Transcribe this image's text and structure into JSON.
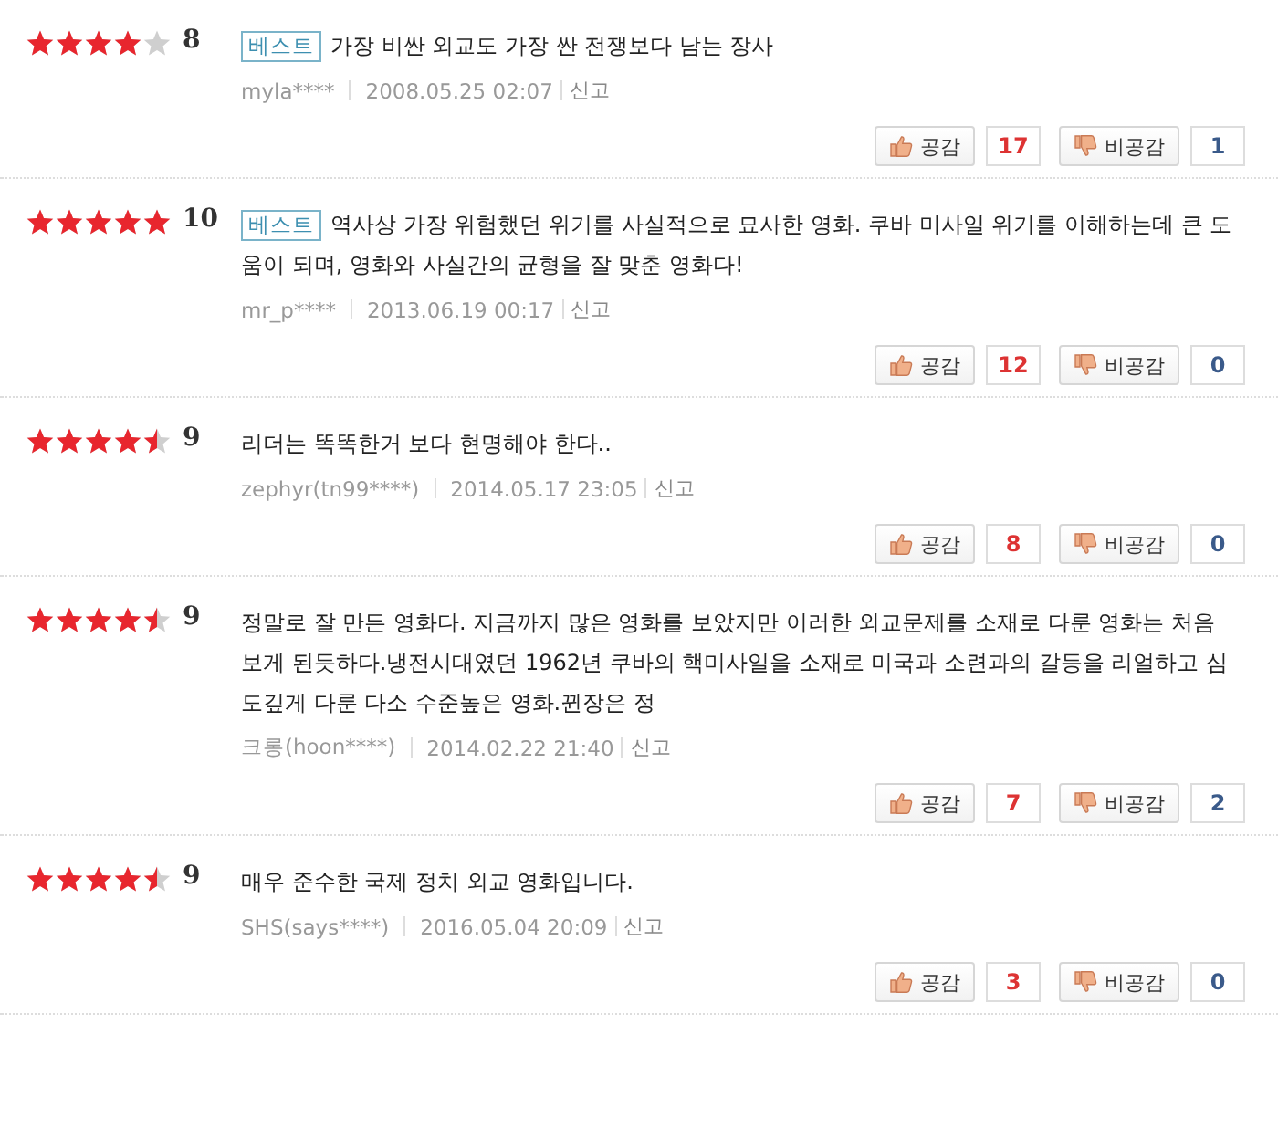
{
  "reviews": [
    {
      "stars": 4,
      "score": "8",
      "best": true,
      "best_label": "베스트",
      "text": "가장 비싼 외교도 가장 싼 전쟁보다 남는 장사",
      "author": "myla****",
      "date": "2008.05.25 02:07",
      "report": "신고",
      "agree_label": "공감",
      "agree_count": "17",
      "disagree_label": "비공감",
      "disagree_count": "1"
    },
    {
      "stars": 5,
      "score": "10",
      "best": true,
      "best_label": "베스트",
      "text": "역사상 가장 위험했던 위기를 사실적으로 묘사한 영화. 쿠바 미사일 위기를 이해하는데 큰 도움이 되며, 영화와 사실간의 균형을 잘 맞춘 영화다!",
      "author": "mr_p****",
      "date": "2013.06.19 00:17",
      "report": "신고",
      "agree_label": "공감",
      "agree_count": "12",
      "disagree_label": "비공감",
      "disagree_count": "0"
    },
    {
      "stars": 4.5,
      "score": "9",
      "best": false,
      "text": "리더는 똑똑한거 보다 현명해야 한다..",
      "author": "zephyr(tn99****)",
      "date": "2014.05.17 23:05",
      "report": "신고",
      "agree_label": "공감",
      "agree_count": "8",
      "disagree_label": "비공감",
      "disagree_count": "0"
    },
    {
      "stars": 4.5,
      "score": "9",
      "best": false,
      "text": "정말로 잘 만든 영화다. 지금까지 많은 영화를 보았지만 이러한 외교문제를 소재로 다룬 영화는 처음 보게 된듯하다.냉전시대였던 1962년 쿠바의 핵미사일을 소재로 미국과 소련과의 갈등을 리얼하고 심도깊게 다룬 다소 수준높은 영화.뀐장은 정",
      "author": "크롱(hoon****)",
      "date": "2014.02.22 21:40",
      "report": "신고",
      "agree_label": "공감",
      "agree_count": "7",
      "disagree_label": "비공감",
      "disagree_count": "2"
    },
    {
      "stars": 4.5,
      "score": "9",
      "best": false,
      "text": "매우 준수한 국제 정치 외교 영화입니다.",
      "author": "SHS(says****)",
      "date": "2016.05.04 20:09",
      "report": "신고",
      "agree_label": "공감",
      "agree_count": "3",
      "disagree_label": "비공감",
      "disagree_count": "0"
    }
  ]
}
